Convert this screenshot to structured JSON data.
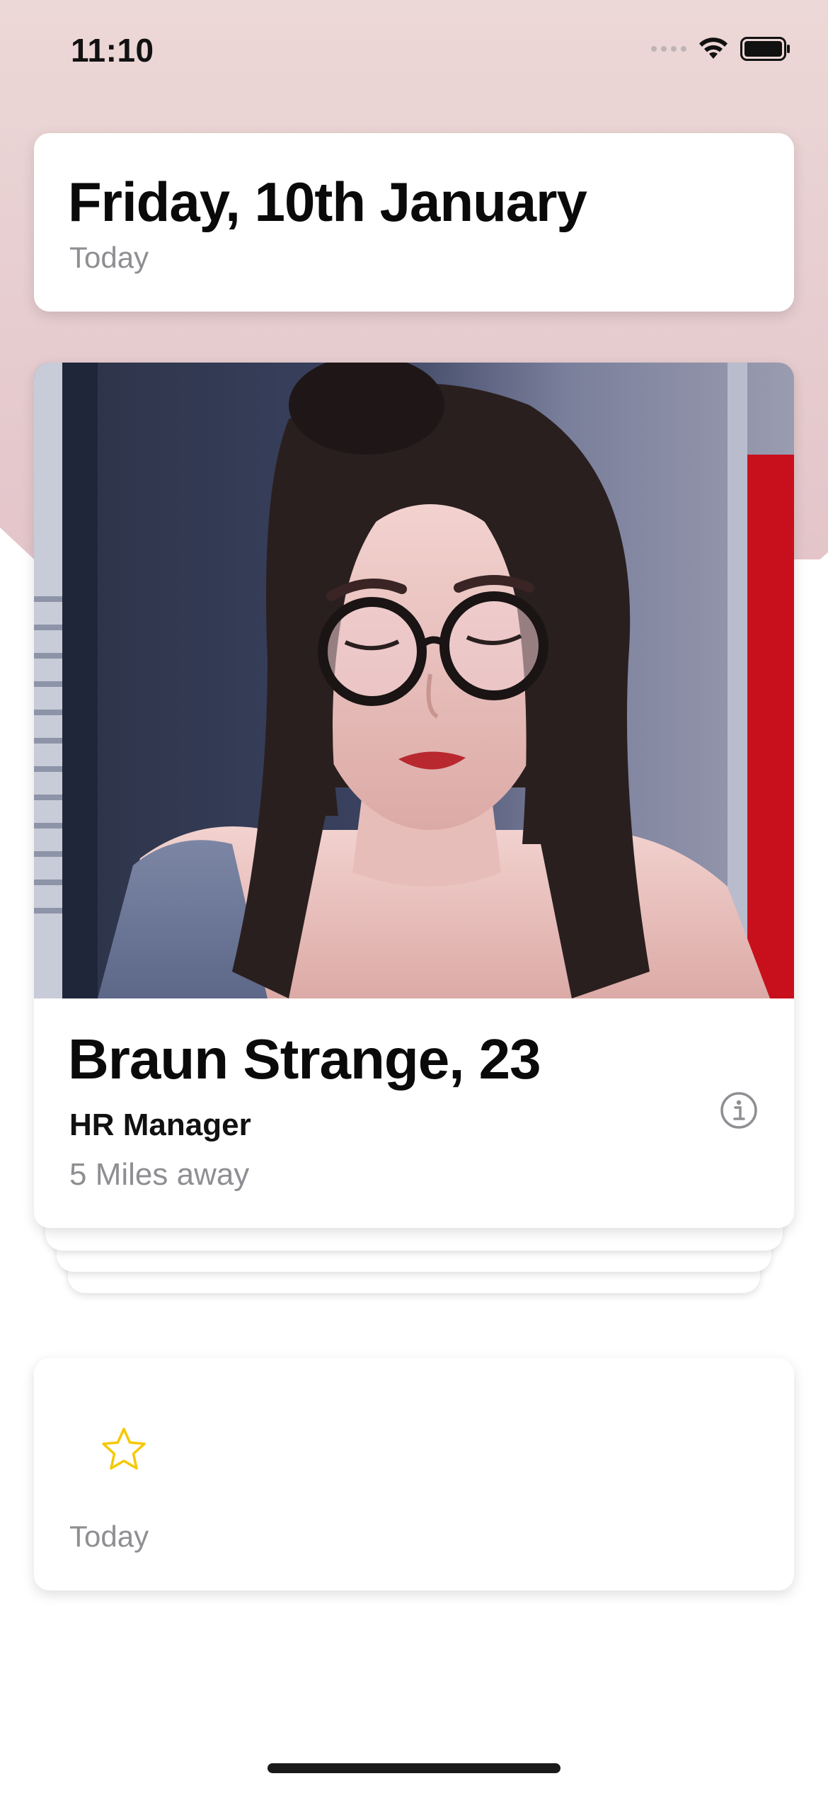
{
  "status_bar": {
    "time": "11:10"
  },
  "date_header": {
    "title": "Friday, 10th January",
    "subtitle": "Today"
  },
  "profile": {
    "name_age": "Braun Strange, 23",
    "job": "HR Manager",
    "distance": "5 Miles away"
  },
  "favorite_card": {
    "subtitle": "Today",
    "icon": "star-icon"
  },
  "icons": {
    "info": "info-icon",
    "wifi": "wifi-icon",
    "battery": "battery-icon",
    "signal": "signal-icon"
  },
  "colors": {
    "background_top": "#e6ccd0",
    "star": "#f5c800",
    "secondary_text": "#8e8e93"
  }
}
